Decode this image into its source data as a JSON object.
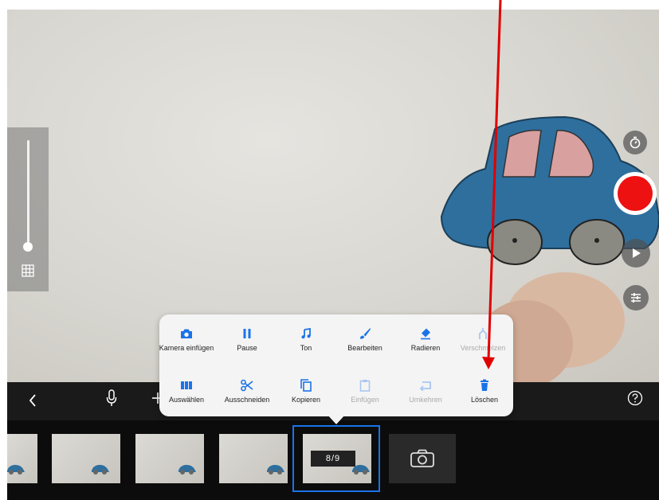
{
  "timeline_frame": {
    "counter": "8/9"
  },
  "popup": {
    "row1": [
      {
        "label": "Kamera einfügen",
        "icon": "camera-icon",
        "enabled": true
      },
      {
        "label": "Pause",
        "icon": "pause-icon",
        "enabled": true
      },
      {
        "label": "Ton",
        "icon": "music-note-icon",
        "enabled": true
      },
      {
        "label": "Bearbeiten",
        "icon": "brush-icon",
        "enabled": true
      },
      {
        "label": "Radieren",
        "icon": "eraser-icon",
        "enabled": true
      },
      {
        "label": "Verschmelzen",
        "icon": "merge-icon",
        "enabled": false
      }
    ],
    "row2": [
      {
        "label": "Auswählen",
        "icon": "select-frames-icon",
        "enabled": true
      },
      {
        "label": "Ausschneiden",
        "icon": "scissors-icon",
        "enabled": true
      },
      {
        "label": "Kopieren",
        "icon": "copy-icon",
        "enabled": true
      },
      {
        "label": "Einfügen",
        "icon": "paste-icon",
        "enabled": false
      },
      {
        "label": "Umkehren",
        "icon": "reverse-icon",
        "enabled": false
      },
      {
        "label": "Löschen",
        "icon": "trash-icon",
        "enabled": true
      }
    ]
  },
  "colors": {
    "accent": "#1a73e8",
    "record": "#ee1111",
    "annotation_arrow": "#e00000",
    "car_body": "#2e6f9e"
  }
}
